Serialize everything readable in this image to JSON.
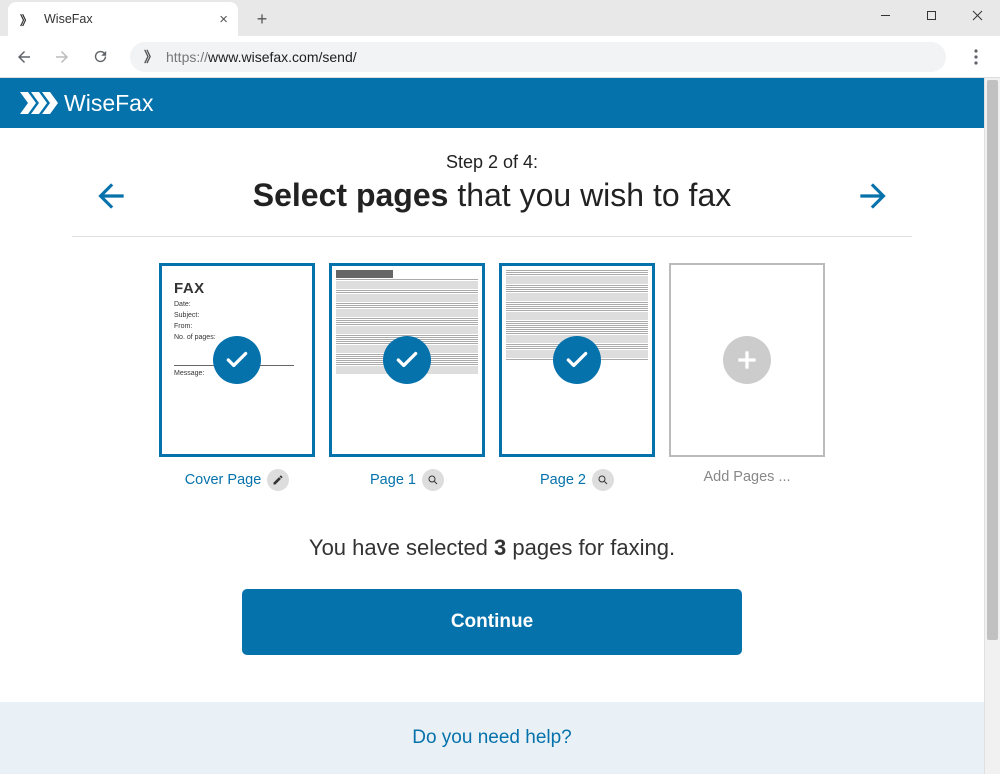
{
  "browser": {
    "tab_title": "WiseFax",
    "url_protocol": "https://",
    "url_rest": "www.wisefax.com/send/"
  },
  "brand": {
    "name": "WiseFax",
    "accent": "#0572ab"
  },
  "step": {
    "label": "Step 2 of 4:",
    "title_bold": "Select pages",
    "title_rest": " that you wish to fax"
  },
  "thumbs": {
    "cover": {
      "label": "Cover Page",
      "heading": "FAX"
    },
    "page1": {
      "label": "Page 1"
    },
    "page2": {
      "label": "Page 2"
    },
    "add": {
      "label": "Add Pages ..."
    }
  },
  "summary": {
    "pre": "You have selected ",
    "count": "3",
    "post": " pages for faxing."
  },
  "actions": {
    "continue": "Continue"
  },
  "help": {
    "prompt": "Do you need help?"
  }
}
